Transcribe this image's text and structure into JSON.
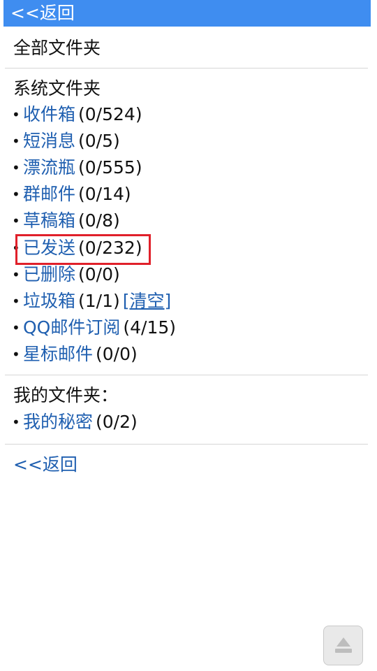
{
  "header": {
    "back_label": "<<返回"
  },
  "all_folders_label": "全部文件夹",
  "system_section": {
    "title": "系统文件夹",
    "items": [
      {
        "name": "收件箱",
        "count": "(0/524)"
      },
      {
        "name": "短消息",
        "count": "(0/5)"
      },
      {
        "name": "漂流瓶",
        "count": "(0/555)"
      },
      {
        "name": "群邮件",
        "count": "(0/14)"
      },
      {
        "name": "草稿箱",
        "count": "(0/8)"
      },
      {
        "name": "已发送",
        "count": "(0/232)"
      },
      {
        "name": "已删除",
        "count": "(0/0)"
      },
      {
        "name": "垃圾箱",
        "count": "(1/1)",
        "extra": "[清空]"
      },
      {
        "name": "QQ邮件订阅",
        "count": "(4/15)"
      },
      {
        "name": "星标邮件",
        "count": "(0/0)"
      }
    ]
  },
  "my_section": {
    "title": "我的文件夹：",
    "items": [
      {
        "name": "我的秘密",
        "count": "(0/2)"
      }
    ]
  },
  "footer": {
    "back_label": "<<返回"
  },
  "colors": {
    "accent": "#3f8df0",
    "link": "#1f5fb0",
    "highlight": "#e0202a"
  },
  "icons": {
    "scroll_top": "arrow-up-icon"
  }
}
